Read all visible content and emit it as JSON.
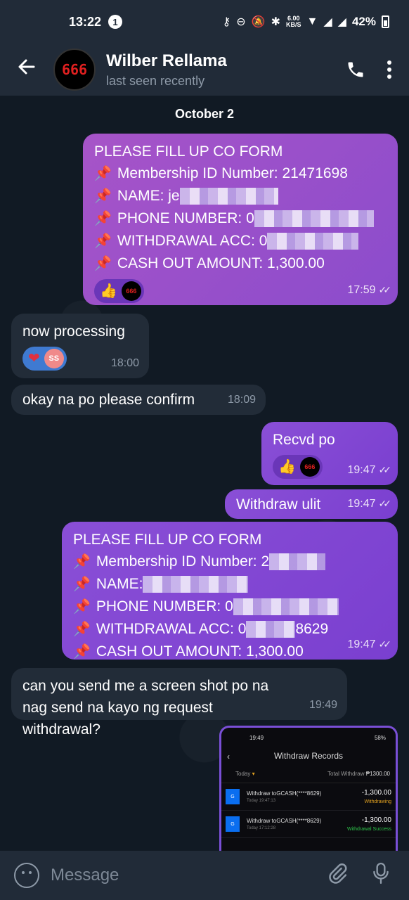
{
  "status_bar": {
    "time": "13:22",
    "notification_count": "1",
    "net_speed_value": "6.00",
    "net_speed_unit": "KB/S",
    "battery": "42%"
  },
  "header": {
    "avatar_text": "666",
    "contact_name": "Wilber Rellama",
    "contact_status": "last seen recently"
  },
  "chat": {
    "date_label": "October 2",
    "messages": [
      {
        "lines": [
          "PLEASE FILL UP CO FORM",
          "Membership ID Number: 21471698",
          "NAME: je",
          "PHONE NUMBER: 0",
          "WITHDRAWAL ACC: 0",
          "CASH OUT AMOUNT: 1,300.00"
        ],
        "time": "17:59"
      },
      {
        "text": "now processing",
        "time": "18:00",
        "reaction_initials": "SS"
      },
      {
        "text": "okay na po please confirm",
        "time": "18:09"
      },
      {
        "text": "Recvd po",
        "time": "19:47"
      },
      {
        "text": "Withdraw ulit",
        "time": "19:47"
      },
      {
        "lines": [
          "PLEASE FILL UP CO FORM",
          "Membership ID Number: 2",
          "NAME:",
          "PHONE NUMBER: 0",
          "WITHDRAWAL ACC: 0",
          "CASH OUT AMOUNT: 1,300.00"
        ],
        "acc_suffix": "8629",
        "time": "19:47"
      },
      {
        "text": "can you send me a screen shot po na nag send na kayo ng request withdrawal?",
        "time": "19:49"
      }
    ],
    "screenshot": {
      "time": "19:49",
      "battery": "58%",
      "title": "Withdraw Records",
      "filter": "Today",
      "total_label": "Total Withdraw",
      "total_value": "₱1300.00",
      "records": [
        {
          "label": "Withdraw toGCASH(****8629)",
          "date": "Today 19:47:13",
          "amount": "-1,300.00",
          "status": "Withdrawing",
          "status_color": "#e0a020"
        },
        {
          "label": "Withdraw toGCASH(****8629)",
          "date": "Today 17:12:28",
          "amount": "-1,300.00",
          "status": "Withdrawal Success",
          "status_color": "#2ec44a"
        }
      ]
    }
  },
  "composer": {
    "placeholder": "Message"
  }
}
